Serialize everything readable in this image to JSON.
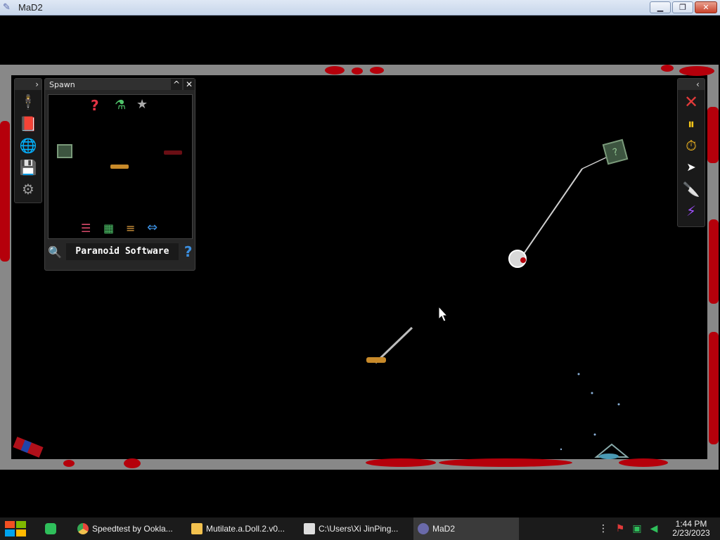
{
  "window": {
    "title": "MaD2",
    "minimize_label": "▁",
    "restore_label": "❐",
    "close_label": "✕"
  },
  "left_toolbar": {
    "expand_label": "›",
    "tools": [
      {
        "name": "ragdoll-icon",
        "glyph": "🕴"
      },
      {
        "name": "book-icon",
        "glyph": "📕"
      },
      {
        "name": "globe-icon",
        "glyph": "🌐"
      },
      {
        "name": "save-icon",
        "glyph": "💾"
      },
      {
        "name": "gear-icon",
        "glyph": "⚙"
      }
    ]
  },
  "spawn_panel": {
    "title": "Spawn",
    "collapse_label": "^",
    "close_label": "✕",
    "categories": [
      {
        "name": "random-category-icon",
        "glyph": "?",
        "color": "#e23344"
      },
      {
        "name": "flask-category-icon",
        "glyph": "⚗",
        "color": "#4fc46a"
      },
      {
        "name": "star-category-icon",
        "glyph": "★",
        "color": "#aaaaaa"
      }
    ],
    "bottom_tabs": [
      {
        "name": "sliders-tab-icon",
        "glyph": "☰",
        "color": "#d84a6a"
      },
      {
        "name": "grid-tab-icon",
        "glyph": "▦",
        "color": "#4fc46a"
      },
      {
        "name": "list-tab-icon",
        "glyph": "≡",
        "color": "#e0a040"
      },
      {
        "name": "swap-tab-icon",
        "glyph": "⇔",
        "color": "#3b8fe0"
      }
    ],
    "search_glyph": "🔍",
    "credit": "Paranoid Software",
    "help_glyph": "?"
  },
  "right_toolbar": {
    "collapse_label": "‹",
    "tools": [
      {
        "name": "delete-tool-icon",
        "glyph": "✕",
        "color": "#e23a3a"
      },
      {
        "name": "pause-icon",
        "glyph": "⏸",
        "color": "#f5c518"
      },
      {
        "name": "stopwatch-icon",
        "glyph": "⏱",
        "color": "#f5b820"
      },
      {
        "name": "pointer-tool-icon",
        "glyph": "➤",
        "color": "#ffffff"
      },
      {
        "name": "knife-tool-icon",
        "glyph": "🔪",
        "color": "#d0a060"
      },
      {
        "name": "lightning-tool-icon",
        "glyph": "⚡",
        "color": "#a050ff"
      }
    ]
  },
  "taskbar": {
    "items": [
      {
        "name": "taskbar-chrome",
        "label": "Speedtest by Ookla...",
        "icon_color": "#e8453c"
      },
      {
        "name": "taskbar-folder",
        "label": "Mutilate.a.Doll.2.v0...",
        "icon_color": "#f2c14e"
      },
      {
        "name": "taskbar-7zip",
        "label": "C:\\Users\\Xi JinPing...",
        "icon_color": "#dddddd"
      },
      {
        "name": "taskbar-mad2",
        "label": "MaD2",
        "icon_color": "#6a6aaa"
      }
    ],
    "time": "1:44 PM",
    "date": "2/23/2023"
  }
}
